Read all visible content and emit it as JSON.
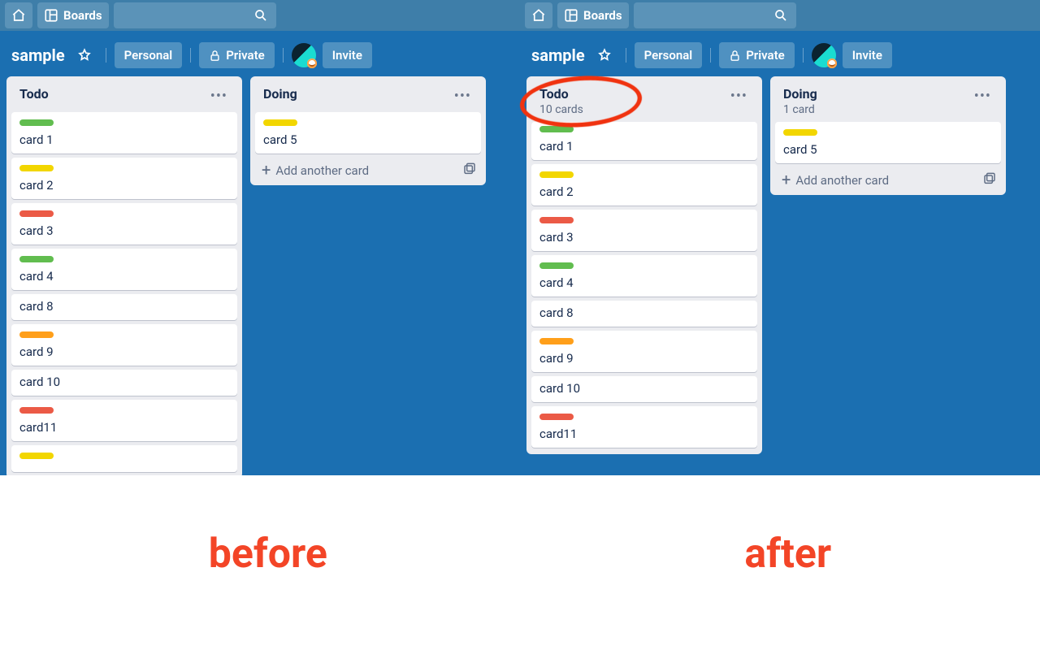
{
  "nav": {
    "boards_label": "Boards"
  },
  "board_header": {
    "title": "sample",
    "personal_label": "Personal",
    "private_label": "Private",
    "invite_label": "Invite"
  },
  "add_card_label": "Add another card",
  "captions": {
    "left": "before",
    "right": "after"
  },
  "panes": [
    {
      "id": "before",
      "lists": [
        {
          "title": "Todo",
          "subtitle": "",
          "cards": [
            {
              "label": "green",
              "title": "card 1"
            },
            {
              "label": "yellow",
              "title": "card 2"
            },
            {
              "label": "red",
              "title": "card 3"
            },
            {
              "label": "green",
              "title": "card 4"
            },
            {
              "label": "",
              "title": "card 8"
            },
            {
              "label": "orange",
              "title": "card 9"
            },
            {
              "label": "",
              "title": "card 10"
            },
            {
              "label": "red",
              "title": "card11"
            },
            {
              "label": "yellow",
              "title": ""
            }
          ],
          "show_add": false
        },
        {
          "title": "Doing",
          "subtitle": "",
          "cards": [
            {
              "label": "yellow",
              "title": "card 5"
            }
          ],
          "show_add": true
        }
      ]
    },
    {
      "id": "after",
      "lists": [
        {
          "title": "Todo",
          "subtitle": "10 cards",
          "cards": [
            {
              "label": "green",
              "title": "card 1",
              "tight": true
            },
            {
              "label": "yellow",
              "title": "card 2"
            },
            {
              "label": "red",
              "title": "card 3"
            },
            {
              "label": "green",
              "title": "card 4"
            },
            {
              "label": "",
              "title": "card 8"
            },
            {
              "label": "orange",
              "title": "card 9"
            },
            {
              "label": "",
              "title": "card 10"
            },
            {
              "label": "red",
              "title": "card11"
            }
          ],
          "show_add": false
        },
        {
          "title": "Doing",
          "subtitle": "1 card",
          "cards": [
            {
              "label": "yellow",
              "title": "card 5"
            }
          ],
          "show_add": true
        }
      ]
    }
  ]
}
